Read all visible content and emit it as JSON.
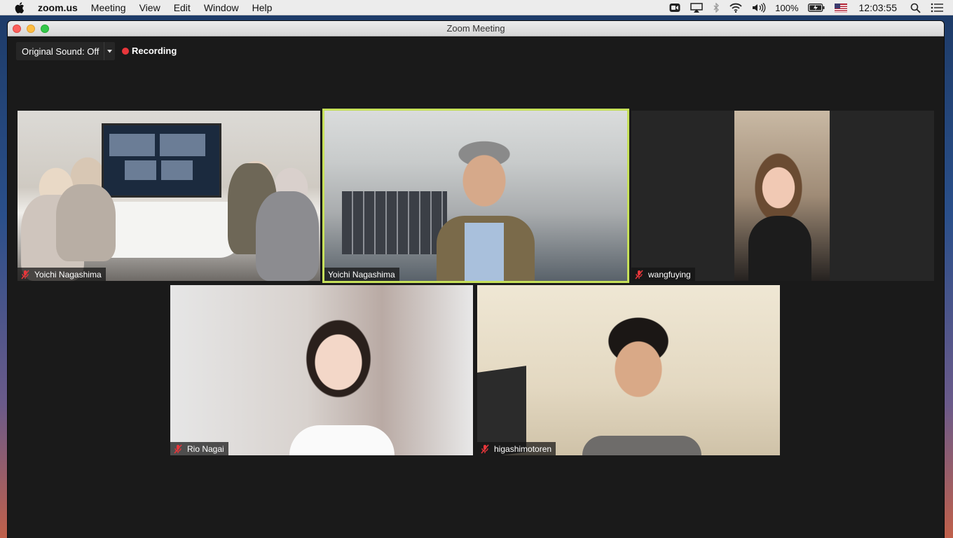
{
  "menubar": {
    "app_name": "zoom.us",
    "items": [
      "Meeting",
      "View",
      "Edit",
      "Window",
      "Help"
    ],
    "battery_percent": "100%",
    "clock": "12:03:55"
  },
  "window": {
    "title": "Zoom Meeting"
  },
  "controls": {
    "original_sound_label": "Original Sound: Off",
    "recording_label": "Recording",
    "recording_color": "#e8363b"
  },
  "participants": [
    {
      "name": "Yoichi Nagashima",
      "muted": true,
      "active_speaker": false
    },
    {
      "name": "Yoichi Nagashima",
      "muted": false,
      "active_speaker": true
    },
    {
      "name": "wangfuying",
      "muted": true,
      "active_speaker": false
    },
    {
      "name": "Rio Nagai",
      "muted": true,
      "active_speaker": false
    },
    {
      "name": "higashimotoren",
      "muted": true,
      "active_speaker": false
    }
  ],
  "colors": {
    "active_speaker_border": "#c6e05a",
    "mute_icon": "#e8363b",
    "window_bg": "#1a1a1a"
  }
}
